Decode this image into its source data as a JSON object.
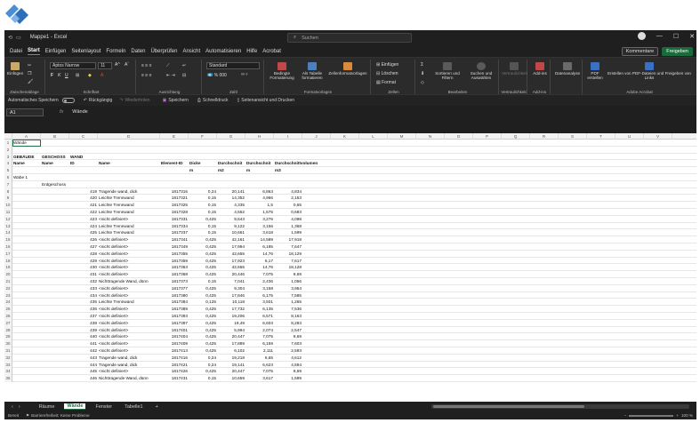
{
  "window": {
    "title": "Mappe1 - Excel",
    "search_placeholder": "Suchen"
  },
  "titlebar_buttons": {
    "minimize": "—",
    "maximize": "☐",
    "close": "✕"
  },
  "tabs": [
    "Datei",
    "Start",
    "Einfügen",
    "Seitenlayout",
    "Formeln",
    "Daten",
    "Überprüfen",
    "Ansicht",
    "Automatisieren",
    "Hilfe",
    "Acrobat"
  ],
  "active_tab": "Start",
  "tab_buttons": {
    "comments": "Kommentare",
    "share": "Freigeben"
  },
  "ribbon": {
    "clipboard": {
      "label": "Zwischenablage",
      "paste": "Einfügen"
    },
    "font": {
      "label": "Schriftart",
      "font_name": "Aptos Narrow",
      "font_size": "11"
    },
    "alignment": {
      "label": "Ausrichtung"
    },
    "number": {
      "label": "Zahl",
      "format": "Standard"
    },
    "styles": {
      "label": "Formatvorlagen",
      "conditional": "Bedingte Formatierung",
      "as_table": "Als Tabelle formatieren",
      "cell_styles": "Zellenformatvorlagen"
    },
    "cells": {
      "label": "Zellen",
      "insert": "Einfügen",
      "delete": "Löschen",
      "format": "Format"
    },
    "editing": {
      "label": "Bearbeiten",
      "sort": "Sortieren und Filtern",
      "find": "Suchen und Auswählen"
    },
    "sensitivity": {
      "label": "Vertraulichkeit",
      "btn": "Vertraulichkeit"
    },
    "addins": {
      "label": "Add-ins",
      "btn": "Add-ins"
    },
    "analysis": {
      "btn": "Datenanalyse"
    },
    "acrobat": {
      "label": "Adobe Acrobat",
      "pdf": "PDF erstellen",
      "pdf_links": "Erstellen von PDF-Dateien und Freigeben von Links"
    }
  },
  "autosave": {
    "label": "Automatisches Speichern",
    "undo": "Rückgängig",
    "redo": "Wiederholen",
    "save": "Speichern",
    "quickprint": "Schnelldruck",
    "preview": "Seitenansicht und Drucken"
  },
  "formula_bar": {
    "name_box": "A1",
    "fx": "fx",
    "value": "Wände"
  },
  "columns": [
    "A",
    "B",
    "C",
    "D",
    "E",
    "F",
    "G",
    "H",
    "I",
    "J",
    "K",
    "L",
    "M",
    "N",
    "O",
    "P",
    "Q",
    "R",
    "S",
    "T",
    "U",
    "V"
  ],
  "header_rows": {
    "r1": {
      "A": "Wände"
    },
    "r3": {
      "A": "GEBÄUDE",
      "B": "GESCHOSS",
      "C": "WAND"
    },
    "r4": {
      "A": "Name",
      "B": "Name",
      "C": "ID",
      "D": "Name",
      "E": "Element-ID",
      "F": "Dicke",
      "G": "Durchschnit",
      "H": "Durchschnit",
      "I": "Durchschnittvolumen"
    },
    "r5": {
      "F": "m",
      "G": "m2",
      "H": "m",
      "I": "m3"
    },
    "r6": {
      "A": "Wabe 1"
    },
    "r7": {
      "B": "Erdgeschoss"
    }
  },
  "data_rows": [
    {
      "row": "8",
      "id": "419",
      "name": "Tragende wand, dick",
      "eid": "1817316",
      "dicke": "0,24",
      "flaeche": "20,141",
      "hoehe": "6,863",
      "vol": "4,834"
    },
    {
      "row": "9",
      "id": "420",
      "name": "Leichte Trennwand",
      "eid": "1817321",
      "dicke": "0,15",
      "flaeche": "14,352",
      "hoehe": "4,966",
      "vol": "2,153"
    },
    {
      "row": "10",
      "id": "421",
      "name": "Leichte Trennwand",
      "eid": "1817325",
      "dicke": "0,15",
      "flaeche": "4,335",
      "hoehe": "1,5",
      "vol": "0,65"
    },
    {
      "row": "11",
      "id": "422",
      "name": "Leichte Trennwand",
      "eid": "1817328",
      "dicke": "0,15",
      "flaeche": "4,552",
      "hoehe": "1,575",
      "vol": "0,683"
    },
    {
      "row": "12",
      "id": "423",
      "name": "<nicht definiert>",
      "eid": "1817331",
      "dicke": "0,425",
      "flaeche": "9,643",
      "hoehe": "3,276",
      "vol": "4,098"
    },
    {
      "row": "13",
      "id": "424",
      "name": "Leichte Trennwand",
      "eid": "1817334",
      "dicke": "0,15",
      "flaeche": "9,122",
      "hoehe": "3,156",
      "vol": "1,368"
    },
    {
      "row": "14",
      "id": "425",
      "name": "Leichte Trennwand",
      "eid": "1817337",
      "dicke": "0,15",
      "flaeche": "10,661",
      "hoehe": "3,618",
      "vol": "1,599"
    },
    {
      "row": "15",
      "id": "426",
      "name": "<nicht definiert>",
      "eid": "1817341",
      "dicke": "0,425",
      "flaeche": "42,161",
      "hoehe": "14,589",
      "vol": "17,918"
    },
    {
      "row": "16",
      "id": "427",
      "name": "<nicht definiert>",
      "eid": "1817349",
      "dicke": "0,425",
      "flaeche": "17,994",
      "hoehe": "6,195",
      "vol": "7,647"
    },
    {
      "row": "17",
      "id": "428",
      "name": "<nicht definiert>",
      "eid": "1817355",
      "dicke": "0,425",
      "flaeche": "42,655",
      "hoehe": "14,76",
      "vol": "18,129"
    },
    {
      "row": "18",
      "id": "429",
      "name": "<nicht definiert>",
      "eid": "1817359",
      "dicke": "0,425",
      "flaeche": "17,923",
      "hoehe": "6,17",
      "vol": "7,617"
    },
    {
      "row": "19",
      "id": "430",
      "name": "<nicht definiert>",
      "eid": "1817363",
      "dicke": "0,425",
      "flaeche": "42,655",
      "hoehe": "14,76",
      "vol": "18,128"
    },
    {
      "row": "20",
      "id": "431",
      "name": "<nicht definiert>",
      "eid": "1817368",
      "dicke": "0,425",
      "flaeche": "20,446",
      "hoehe": "7,075",
      "vol": "8,69"
    },
    {
      "row": "21",
      "id": "432",
      "name": "Nichttragende Wand, dünn",
      "eid": "1817373",
      "dicke": "0,15",
      "flaeche": "7,041",
      "hoehe": "2,436",
      "vol": "1,056"
    },
    {
      "row": "22",
      "id": "433",
      "name": "<nicht definiert>",
      "eid": "1817377",
      "dicke": "0,425",
      "flaeche": "9,304",
      "hoehe": "3,158",
      "vol": "3,954"
    },
    {
      "row": "23",
      "id": "434",
      "name": "<nicht definiert>",
      "eid": "1817380",
      "dicke": "0,425",
      "flaeche": "17,846",
      "hoehe": "6,175",
      "vol": "7,585"
    },
    {
      "row": "24",
      "id": "435",
      "name": "Leichte Trennwand",
      "eid": "1817384",
      "dicke": "0,125",
      "flaeche": "10,118",
      "hoehe": "3,501",
      "vol": "1,265"
    },
    {
      "row": "25",
      "id": "436",
      "name": "<nicht definiert>",
      "eid": "1817389",
      "dicke": "0,425",
      "flaeche": "17,732",
      "hoehe": "6,135",
      "vol": "7,536"
    },
    {
      "row": "26",
      "id": "437",
      "name": "<nicht definiert>",
      "eid": "1817393",
      "dicke": "0,425",
      "flaeche": "19,206",
      "hoehe": "6,571",
      "vol": "8,163"
    },
    {
      "row": "27",
      "id": "438",
      "name": "<nicht definiert>",
      "eid": "1817397",
      "dicke": "0,425",
      "flaeche": "19,49",
      "hoehe": "6,603",
      "vol": "8,283"
    },
    {
      "row": "28",
      "id": "439",
      "name": "<nicht definiert>",
      "eid": "1817401",
      "dicke": "0,425",
      "flaeche": "5,994",
      "hoehe": "2,074",
      "vol": "2,547"
    },
    {
      "row": "29",
      "id": "440",
      "name": "<nicht definiert>",
      "eid": "1817404",
      "dicke": "0,425",
      "flaeche": "20,447",
      "hoehe": "7,075",
      "vol": "8,69"
    },
    {
      "row": "30",
      "id": "441",
      "name": "<nicht definiert>",
      "eid": "1817409",
      "dicke": "0,425",
      "flaeche": "17,889",
      "hoehe": "6,159",
      "vol": "7,603"
    },
    {
      "row": "31",
      "id": "442",
      "name": "<nicht definiert>",
      "eid": "1817413",
      "dicke": "0,425",
      "flaeche": "6,102",
      "hoehe": "2,111",
      "vol": "2,593"
    },
    {
      "row": "32",
      "id": "443",
      "name": "Tragende wand, dick",
      "eid": "1817416",
      "dicke": "0,24",
      "flaeche": "19,218",
      "hoehe": "6,65",
      "vol": "4,612"
    },
    {
      "row": "33",
      "id": "444",
      "name": "Tragende wand, dick",
      "eid": "1817421",
      "dicke": "0,24",
      "flaeche": "19,141",
      "hoehe": "6,623",
      "vol": "4,594"
    },
    {
      "row": "34",
      "id": "445",
      "name": "<nicht definiert>",
      "eid": "1817426",
      "dicke": "0,425",
      "flaeche": "20,447",
      "hoehe": "7,075",
      "vol": "8,69"
    },
    {
      "row": "35",
      "id": "446",
      "name": "Nichttragende Wand, dünn",
      "eid": "1817431",
      "dicke": "0,15",
      "flaeche": "10,659",
      "hoehe": "3,617",
      "vol": "1,599"
    }
  ],
  "sheet_tabs": [
    "Räume",
    "Wände",
    "Fenster",
    "Tabelle1"
  ],
  "active_sheet": "Wände",
  "add_sheet": "+",
  "status": {
    "ready": "Bereit",
    "accessibility": "Barrierefreiheit: Keine Probleme",
    "zoom": "100 %"
  }
}
